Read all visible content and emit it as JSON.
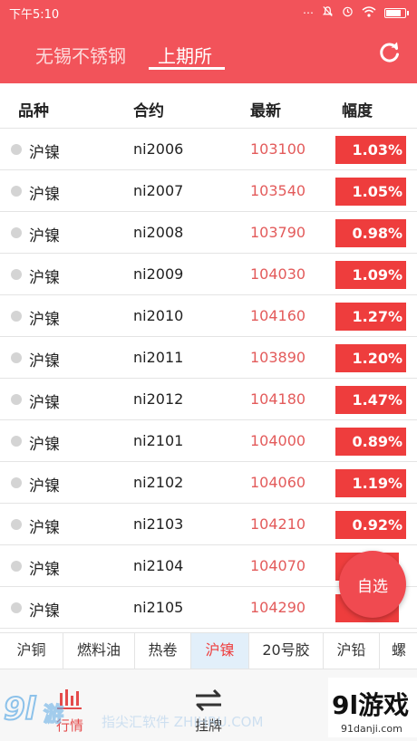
{
  "status_bar": {
    "time": "下午5:10",
    "icons": [
      "more-icon",
      "mute-icon",
      "alarm-icon",
      "wifi-icon",
      "battery-icon"
    ]
  },
  "header": {
    "tabs": [
      {
        "label": "无锡不锈钢",
        "active": false
      },
      {
        "label": "上期所",
        "active": true
      }
    ],
    "refresh_icon": "refresh-icon"
  },
  "table": {
    "columns": [
      "品种",
      "合约",
      "最新",
      "幅度"
    ],
    "rows": [
      {
        "name": "沪镍",
        "contract": "ni2006",
        "price": "103100",
        "change": "1.03%"
      },
      {
        "name": "沪镍",
        "contract": "ni2007",
        "price": "103540",
        "change": "1.05%"
      },
      {
        "name": "沪镍",
        "contract": "ni2008",
        "price": "103790",
        "change": "0.98%"
      },
      {
        "name": "沪镍",
        "contract": "ni2009",
        "price": "104030",
        "change": "1.09%"
      },
      {
        "name": "沪镍",
        "contract": "ni2010",
        "price": "104160",
        "change": "1.27%"
      },
      {
        "name": "沪镍",
        "contract": "ni2011",
        "price": "103890",
        "change": "1.20%"
      },
      {
        "name": "沪镍",
        "contract": "ni2012",
        "price": "104180",
        "change": "1.47%"
      },
      {
        "name": "沪镍",
        "contract": "ni2101",
        "price": "104000",
        "change": "0.89%"
      },
      {
        "name": "沪镍",
        "contract": "ni2102",
        "price": "104060",
        "change": "1.19%"
      },
      {
        "name": "沪镍",
        "contract": "ni2103",
        "price": "104210",
        "change": "0.92%"
      },
      {
        "name": "沪镍",
        "contract": "ni2104",
        "price": "104070",
        "change": ""
      },
      {
        "name": "沪镍",
        "contract": "ni2105",
        "price": "104290",
        "change": ""
      }
    ]
  },
  "fab": {
    "label": "自选"
  },
  "subtabs": {
    "items": [
      "沪铜",
      "燃料油",
      "热卷",
      "沪镍",
      "20号胶",
      "沪铅",
      "螺"
    ],
    "active_index": 3
  },
  "bottom_nav": {
    "items": [
      {
        "label": "行情",
        "icon": "chart-bars-icon",
        "active": true
      },
      {
        "label": "挂牌",
        "icon": "swap-arrows-icon",
        "active": false
      }
    ]
  },
  "watermark": {
    "logo_text": "9l游戏",
    "domain": "91danji.com",
    "faint_text": "指尖汇软件 ZHIHRU.COM"
  },
  "colors": {
    "brand": "#f2535a",
    "up": "#ee3d3d",
    "price": "#e35b5b",
    "active_subtab_bg": "#e2effa"
  }
}
